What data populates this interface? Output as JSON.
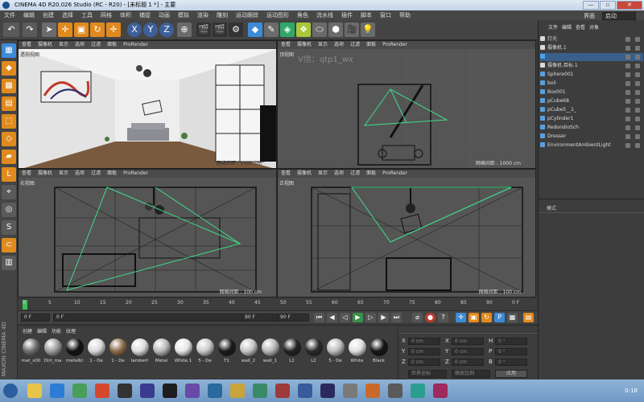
{
  "window": {
    "title": "CINEMA 4D R20.026 Studio (RC - R20) - [未标题 1 *] - 主要"
  },
  "menu": [
    "文件",
    "编辑",
    "创建",
    "选择",
    "工具",
    "网格",
    "体积",
    "捕捉",
    "动画",
    "模拟",
    "渲染",
    "雕刻",
    "运动跟踪",
    "运动图形",
    "角色",
    "流水线",
    "插件",
    "脚本",
    "窗口",
    "帮助"
  ],
  "interface": {
    "label": "界面",
    "value": "启动"
  },
  "viewport_menu": [
    "查看",
    "摄像机",
    "显示",
    "选项",
    "过滤",
    "面板",
    "ProRender"
  ],
  "viewports": {
    "perspective": {
      "label": "透视视图",
      "grid": "网格间距 : 1000 cm"
    },
    "top": {
      "label": "顶视图",
      "grid": "网格间距 : 1000 cm",
      "watermark": "V信：qtp1_wx"
    },
    "right": {
      "label": "右视图",
      "grid": "网格间距 : 100 cm"
    },
    "front": {
      "label": "正视图",
      "grid": "网格间距 : 100 cm"
    }
  },
  "timeline": {
    "ticks": [
      "0",
      "5",
      "10",
      "15",
      "20",
      "25",
      "30",
      "35",
      "40",
      "45",
      "50",
      "55",
      "60",
      "65",
      "70",
      "75",
      "80",
      "85",
      "90"
    ],
    "end": "0 F"
  },
  "playbar": {
    "current": "0 F",
    "min": "0 F",
    "field2": "90 F",
    "field3": "90 F"
  },
  "materials": {
    "tabs": [
      "创建",
      "编辑",
      "功能",
      "纹理"
    ],
    "items": [
      {
        "name": "mat_x00",
        "color": "#6d6d6d"
      },
      {
        "name": "Dirt_ma",
        "color": "#9b9b9b"
      },
      {
        "name": "metalbl",
        "color": "#111111"
      },
      {
        "name": "1 - De",
        "color": "#d8d8d8"
      },
      {
        "name": "1 - De",
        "color": "#8b6b4a"
      },
      {
        "name": "lambert",
        "color": "#dcdcdc"
      },
      {
        "name": "Metal",
        "color": "#b9b9b9"
      },
      {
        "name": "White.1",
        "color": "#e6e6e6"
      },
      {
        "name": "5 - De",
        "color": "#c9c9c9"
      },
      {
        "name": "T1",
        "color": "#1a1a1a"
      },
      {
        "name": "wall_2",
        "color": "#c5c5c5"
      },
      {
        "name": "wall_1",
        "color": "#b7b7b7"
      },
      {
        "name": "L1",
        "color": "#222222"
      },
      {
        "name": "L2",
        "color": "#2a2a2a"
      },
      {
        "name": "5 - De",
        "color": "#bcbcbc"
      },
      {
        "name": "White",
        "color": "#e0e0e0"
      },
      {
        "name": "Black",
        "color": "#151515"
      }
    ]
  },
  "coords": {
    "rows": [
      {
        "a": "X",
        "av": "0 cm",
        "b": "X",
        "bv": "0 cm",
        "c": "H",
        "cv": "0 °"
      },
      {
        "a": "Y",
        "av": "0 cm",
        "b": "Y",
        "bv": "0 cm",
        "c": "P",
        "cv": "0 °"
      },
      {
        "a": "Z",
        "av": "0 cm",
        "b": "Z",
        "bv": "0 cm",
        "c": "B",
        "cv": "0 °"
      }
    ],
    "mode1": "世界坐标",
    "mode2": "缩放比例",
    "apply": "应用"
  },
  "objects": {
    "header": [
      "文件",
      "编辑",
      "查看",
      "对象"
    ],
    "items": [
      {
        "name": "灯光",
        "color": "#d9d9d9"
      },
      {
        "name": "摄像机.1",
        "color": "#d9d9d9"
      },
      {
        "name": "",
        "color": "#4aa3f0"
      },
      {
        "name": "摄像机.目标.1",
        "color": "#d9d9d9"
      },
      {
        "name": "Sphere001",
        "color": "#5aa0e0"
      },
      {
        "name": "boli",
        "color": "#5aa0e0"
      },
      {
        "name": "Box001",
        "color": "#5aa0e0"
      },
      {
        "name": "pCube68",
        "color": "#5aa0e0"
      },
      {
        "name": "pCube5__1_",
        "color": "#5aa0e0"
      },
      {
        "name": "pCylinder1",
        "color": "#5aa0e0"
      },
      {
        "name": "RedondioSch",
        "color": "#5aa0e0"
      },
      {
        "name": "Dresser",
        "color": "#5aa0e0"
      },
      {
        "name": "EnvironmentAmbientLight",
        "color": "#5aa0e0"
      }
    ]
  },
  "attr": {
    "mode_label": "模式"
  },
  "brand": {
    "line1": "MAXON",
    "line2": "CINEMA 4D"
  },
  "tray": {
    "time": "0:18"
  }
}
